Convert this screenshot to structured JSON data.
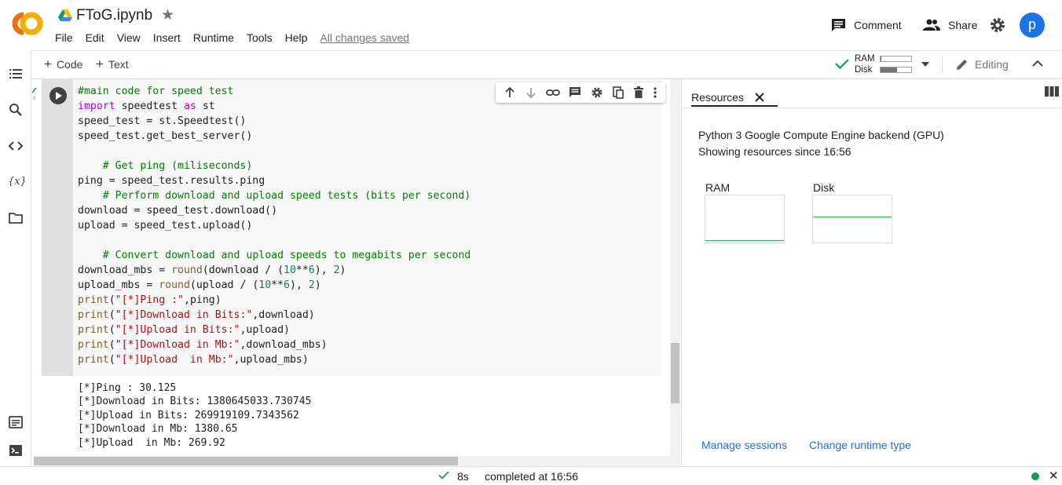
{
  "header": {
    "file_name": "FToG.ipynb",
    "menu": [
      "File",
      "Edit",
      "View",
      "Insert",
      "Runtime",
      "Tools",
      "Help"
    ],
    "save_status": "All changes saved",
    "comment_label": "Comment",
    "share_label": "Share",
    "avatar_letter": "p"
  },
  "toolbar": {
    "add_code_label": "Code",
    "add_text_label": "Text",
    "ram_label": "RAM",
    "disk_label": "Disk",
    "ram_usage": 0.03,
    "disk_usage": 0.55,
    "editing_label": "Editing"
  },
  "cell": {
    "exec_time": "8s",
    "output_lines": [
      "[*]Ping : 30.125",
      "[*]Download in Bits: 1380645033.730745",
      "[*]Upload in Bits: 269919109.7343562",
      "[*]Download in Mb: 1380.65",
      "[*]Upload  in Mb: 269.92"
    ]
  },
  "resources": {
    "tab_label": "Resources",
    "backend": "Python 3 Google Compute Engine backend (GPU)",
    "since": "Showing resources since 16:56",
    "ram_label": "RAM",
    "disk_label": "Disk",
    "ram_level": 0.05,
    "disk_level": 0.55,
    "manage_sessions": "Manage sessions",
    "change_runtime": "Change runtime type"
  },
  "status": {
    "duration": "8s",
    "completed": "completed at 16:56"
  },
  "colors": {
    "accent": "#1a73e8",
    "success": "#0f9d58",
    "logo_orange": "#f9ab00",
    "logo_dark_orange": "#e8710a"
  }
}
